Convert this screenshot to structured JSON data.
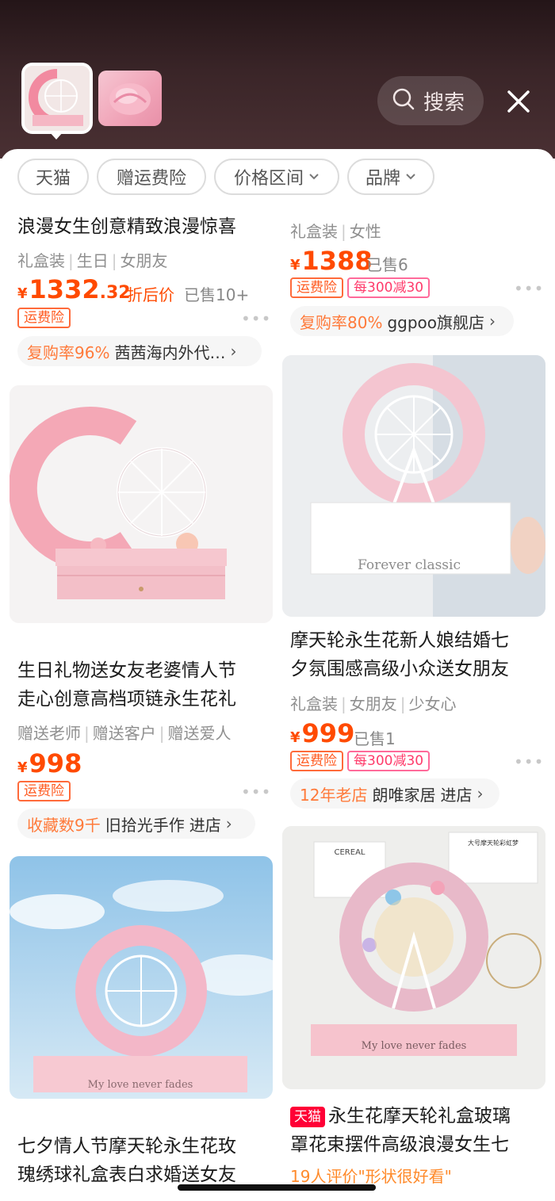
{
  "search": {
    "label": "搜索"
  },
  "filters": [
    {
      "label": "天猫",
      "dropdown": false
    },
    {
      "label": "赠运费险",
      "dropdown": false
    },
    {
      "label": "价格区间",
      "dropdown": true
    },
    {
      "label": "品牌",
      "dropdown": true
    }
  ],
  "products": [
    {
      "title_lines": [
        "浪漫女生创意精致浪漫惊喜"
      ],
      "tags": [
        "礼盒装",
        "生日",
        "女朋友"
      ],
      "price_int": "1332",
      "price_dec": ".32",
      "price_note": "折后价",
      "sold": "已售10+",
      "badges": [
        "运费险"
      ],
      "shop_highlight": "复购率96%",
      "shop_name": "茜茜海内外代…"
    },
    {
      "tags": [
        "礼盒装",
        "女性"
      ],
      "price_int": "1388",
      "sold": "已售6",
      "badges": [
        "运费险",
        "每300减30"
      ],
      "shop_highlight": "复购率80%",
      "shop_name": "ggpoo旗舰店"
    },
    {
      "image_text": "",
      "title_lines": [
        "生日礼物送女友老婆情人节",
        "走心创意高档项链永生花礼"
      ],
      "tags": [
        "赠送老师",
        "赠送客户",
        "赠送爱人"
      ],
      "price_int": "998",
      "badges": [
        "运费险"
      ],
      "shop_highlight": "收藏数9千",
      "shop_name": "旧拾光手作",
      "shop_enter": "进店"
    },
    {
      "image_text": "Forever classic",
      "title_lines": [
        "摩天轮永生花新人娘结婚七",
        "夕氛围感高级小众送女朋友"
      ],
      "tags": [
        "礼盒装",
        "女朋友",
        "少女心"
      ],
      "price_int": "999",
      "sold": "已售1",
      "badges": [
        "运费险",
        "每300减30"
      ],
      "shop_highlight": "12年老店",
      "shop_name": "朗唯家居",
      "shop_enter": "进店"
    },
    {
      "image_text": "My love never fades",
      "title_lines": [
        "七夕情人节摩天轮永生花玫",
        "瑰绣球礼盒表白求婚送女友"
      ]
    },
    {
      "image_text": "My love never fades",
      "image_sign": "CEREAL",
      "image_card_title": "大号摩天轮彩虹梦",
      "tmall_tag": "天猫",
      "title_lines": [
        "永生花摩天轮礼盒玻璃",
        "罩花束摆件高级浪漫女生七"
      ],
      "review": "19人评价\"形状很好看\""
    }
  ],
  "colors": {
    "accent": "#ff4a00",
    "tmall": "#ff0036",
    "topbar": "#2a1a1c"
  }
}
